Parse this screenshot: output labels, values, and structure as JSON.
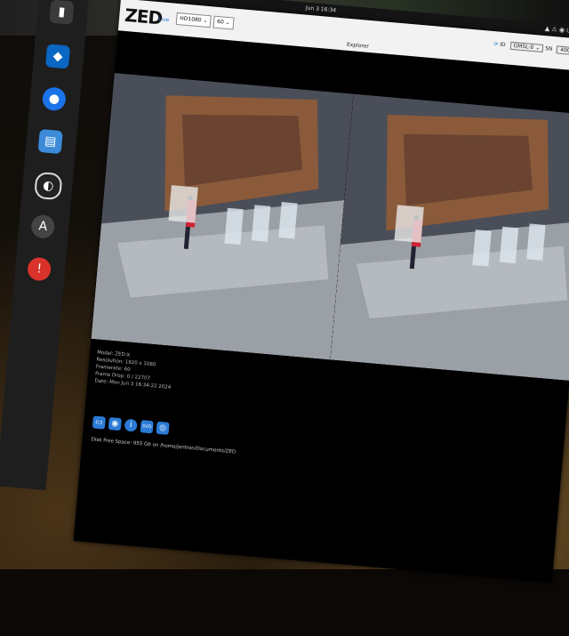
{
  "desktop": {
    "clock": "Jun 3  16:34",
    "tray": [
      "▲",
      "⚠",
      "📶",
      "🔊",
      "⏻"
    ]
  },
  "dock": {
    "icons": [
      "terminal-icon",
      "vscode-icon",
      "chromium-icon",
      "files-icon",
      "obs-icon",
      "app-store-icon",
      "warning-icon"
    ]
  },
  "explorer": {
    "logo": "ZED",
    "logo_sub": "Live",
    "resolution": "HD1080",
    "fps": "60",
    "title": "Explorer",
    "id_label": "ID",
    "id_value": "GMSL-0",
    "sn_label": "SN",
    "sn_value": "40000000",
    "info": {
      "model": "Model:    ZED-X",
      "resolution": "Resolution:  1920 x 1080",
      "framerate": "Framerate:  60",
      "frame_drop": "Frame Drop:  0 / 22707",
      "date": "Date:   Mon Jun 3 16:34:22 2024"
    },
    "status": "Disk Free Space: 955 Gb  on  /home/jentron/Documents/ZED",
    "toolbar": [
      "folder-icon",
      "record-icon",
      "info-icon",
      "svo-icon",
      "camera-icon"
    ]
  },
  "colors": {
    "accent": "#2b7bd6",
    "header": "#f2f2f2"
  }
}
